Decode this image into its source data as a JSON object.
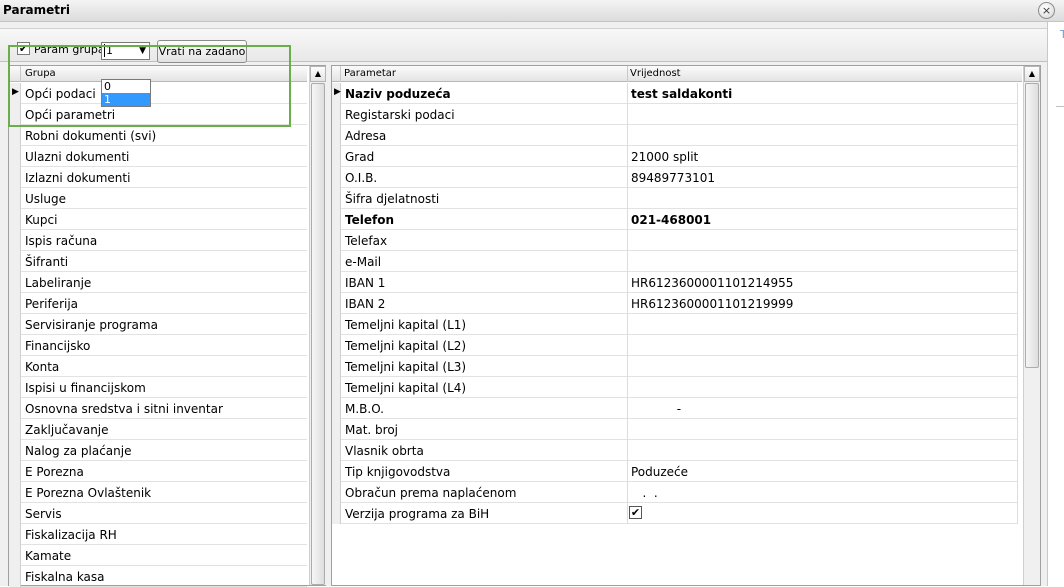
{
  "window": {
    "title": "Parametri",
    "close_icon": "×",
    "right_strip_letter": "T"
  },
  "toolbar": {
    "param_group_checked": true,
    "param_group_label": "Param grupa",
    "group_select_value": "1",
    "group_options": [
      "0",
      "1"
    ],
    "reset_button_label": "Vrati na zadano"
  },
  "left_list": {
    "header": "Grupa",
    "items": [
      "Opći podaci",
      "Opći parametri",
      "Robni dokumenti (svi)",
      "Ulazni dokumenti",
      "Izlazni dokumenti",
      "Usluge",
      "Kupci",
      "Ispis računa",
      "Šifranti",
      "Labeliranje",
      "Periferija",
      "Servisiranje programa",
      "Financijsko",
      "Konta",
      "Ispisi u financijskom",
      "Osnovna sredstva i sitni inventar",
      "Zaključavanje",
      "Nalog za plaćanje",
      "E Porezna",
      "E Porezna Ovlaštenik",
      "Servis",
      "Fiskalizacija RH",
      "Kamate",
      "Fiskalna kasa"
    ]
  },
  "grid": {
    "col_param": "Parametar",
    "col_value": "Vrijednost",
    "rows": [
      {
        "name": "Naziv poduzeća",
        "value": "test saldakonti"
      },
      {
        "name": "Registarski podaci",
        "value": ""
      },
      {
        "name": "Adresa",
        "value": ""
      },
      {
        "name": "Grad",
        "value": "21000 split"
      },
      {
        "name": "O.I.B.",
        "value": "89489773101"
      },
      {
        "name": "Šifra djelatnosti",
        "value": ""
      },
      {
        "name": "Telefon",
        "value": "021-468001"
      },
      {
        "name": "Telefax",
        "value": ""
      },
      {
        "name": "e-Mail",
        "value": ""
      },
      {
        "name": "IBAN 1",
        "value": "HR6123600001101214955"
      },
      {
        "name": "IBAN 2",
        "value": "HR6123600001101219999"
      },
      {
        "name": "Temeljni kapital (L1)",
        "value": ""
      },
      {
        "name": "Temeljni kapital (L2)",
        "value": ""
      },
      {
        "name": "Temeljni kapital (L3)",
        "value": ""
      },
      {
        "name": "Temeljni kapital (L4)",
        "value": ""
      },
      {
        "name": "M.B.O.",
        "value": "            -"
      },
      {
        "name": "Mat. broj",
        "value": ""
      },
      {
        "name": "Vlasnik obrta",
        "value": ""
      },
      {
        "name": "Tip knjigovodstva",
        "value": "Poduzeće"
      },
      {
        "name": "Obračun prema naplaćenom",
        "value": "   .  ."
      },
      {
        "name": "Verzija programa za BiH",
        "value": "✔"
      }
    ]
  },
  "colors": {
    "highlight": "#6aad4a",
    "selection": "#3399ff"
  }
}
